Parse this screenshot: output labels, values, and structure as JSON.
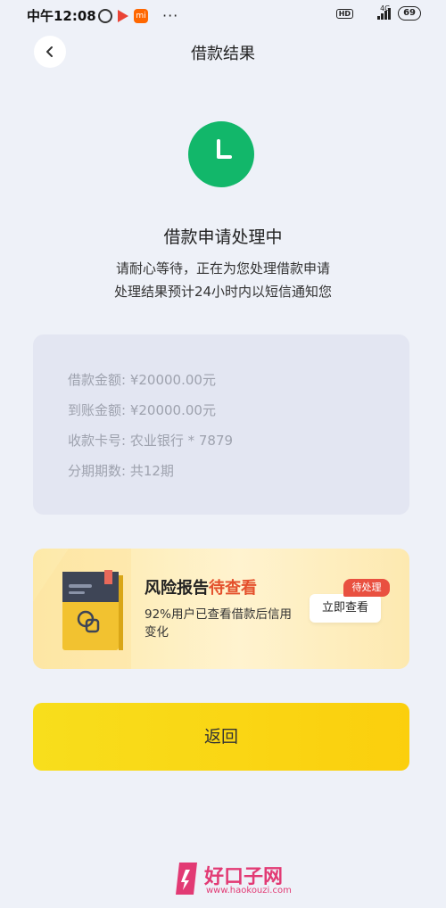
{
  "status_bar": {
    "time": "中午12:08",
    "mi_label": "mi",
    "more": "···",
    "hd": "HD",
    "network": "4G",
    "battery": "69"
  },
  "header": {
    "title": "借款结果"
  },
  "status": {
    "title": "借款申请处理中",
    "desc_line1": "请耐心等待，正在为您处理借款申请",
    "desc_line2": "处理结果预计24小时内以短信通知您",
    "accent": "#12b76a"
  },
  "loan_info": {
    "rows": [
      "借款金额: ¥20000.00元",
      "到账金额: ¥20000.00元",
      "收款卡号: 农业银行 * 7879",
      "分期期数: 共12期"
    ]
  },
  "risk_banner": {
    "title_main": "风险报告",
    "title_highlight": "待查看",
    "desc": "92%用户已查看借款后信用变化",
    "button_label": "立即查看",
    "badge": "待处理",
    "highlight_color": "#e4502c"
  },
  "return_button": {
    "label": "返回",
    "color": "#f9d81a"
  },
  "watermark": {
    "title": "好口子网",
    "url": "www.haokouzi.com"
  }
}
